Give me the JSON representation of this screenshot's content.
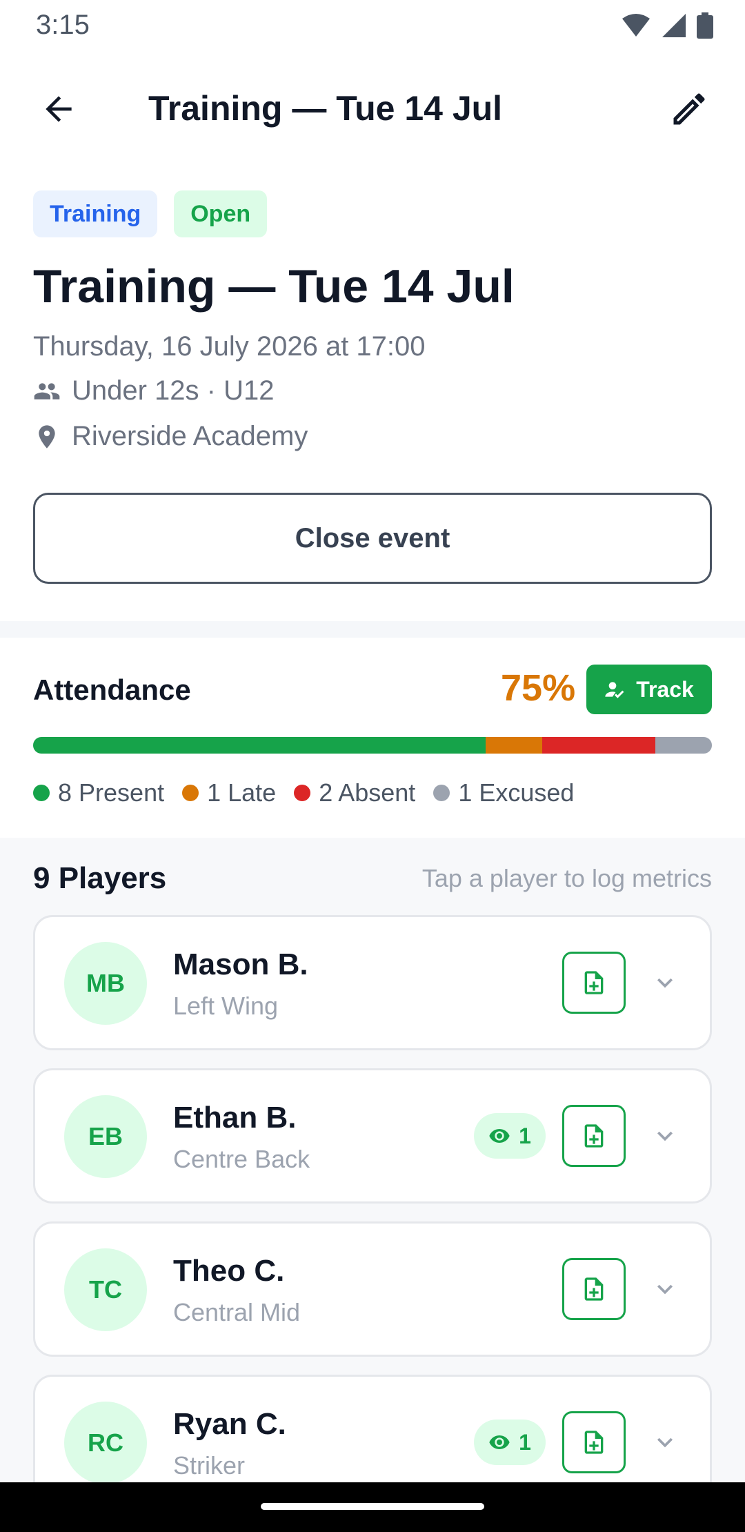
{
  "status_bar": {
    "time": "3:15",
    "icons": [
      "wifi-icon",
      "signal-icon",
      "battery-icon"
    ]
  },
  "app_bar": {
    "title": "Training — Tue 14 Jul",
    "back_icon": "arrow-back-icon",
    "edit_icon": "pencil-icon"
  },
  "event": {
    "type_badge": "Training",
    "status_badge": "Open",
    "title": "Training — Tue 14 Jul",
    "date": "Thursday, 16 July 2026 at 17:00",
    "team": "Under 12s · U12",
    "venue": "Riverside Academy",
    "close_label": "Close event"
  },
  "attendance": {
    "title": "Attendance",
    "percent": "75%",
    "track_label": "Track",
    "segments": [
      {
        "status": "Present",
        "count": 8,
        "label": "8 Present",
        "color": "#16a34a"
      },
      {
        "status": "Late",
        "count": 1,
        "label": "1 Late",
        "color": "#d97706"
      },
      {
        "status": "Absent",
        "count": 2,
        "label": "2 Absent",
        "color": "#dc2626"
      },
      {
        "status": "Excused",
        "count": 1,
        "label": "1 Excused",
        "color": "#9ca3af"
      }
    ]
  },
  "players": {
    "title": "9 Players",
    "hint": "Tap a player to log metrics",
    "items": [
      {
        "initials": "MB",
        "name": "Mason B.",
        "position": "Left Wing",
        "views": null
      },
      {
        "initials": "EB",
        "name": "Ethan B.",
        "position": "Centre Back",
        "views": "1"
      },
      {
        "initials": "TC",
        "name": "Theo C.",
        "position": "Central Mid",
        "views": null
      },
      {
        "initials": "RC",
        "name": "Ryan C.",
        "position": "Striker",
        "views": "1"
      }
    ]
  },
  "colors": {
    "accent": "#16a34a",
    "warning": "#d97706",
    "info": "#2563eb"
  }
}
